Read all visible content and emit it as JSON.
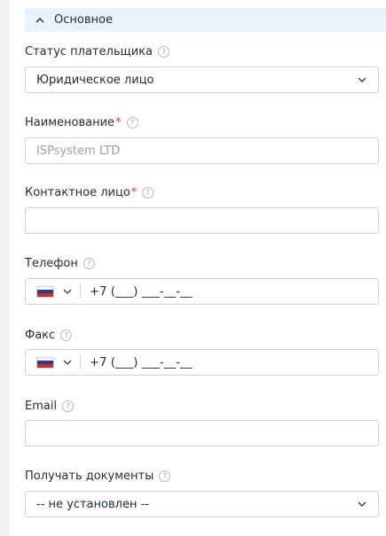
{
  "section": {
    "title": "Основное"
  },
  "fields": {
    "payer_status": {
      "label": "Статус плательщика",
      "help": "?",
      "value": "Юридическое лицо"
    },
    "name": {
      "label": "Наименование",
      "required": "*",
      "help": "?",
      "placeholder": "ISPsystem LTD"
    },
    "contact": {
      "label": "Контактное лицо",
      "required": "*",
      "help": "?",
      "value": ""
    },
    "phone": {
      "label": "Телефон",
      "help": "?",
      "country": "RU",
      "value": "+7 (___) ___-__-__"
    },
    "fax": {
      "label": "Факс",
      "help": "?",
      "country": "RU",
      "value": "+7 (___) ___-__-__"
    },
    "email": {
      "label": "Email",
      "help": "?",
      "value": ""
    },
    "documents": {
      "label": "Получать документы",
      "help": "?",
      "value": "-- не установлен --"
    }
  },
  "colors": {
    "header_bg": "#e9f3fd",
    "required": "#e0342c",
    "border": "#cfd3d8"
  },
  "icons": {
    "section_toggle": "chevron-up-icon",
    "dropdown": "chevron-down-icon",
    "help": "question-circle-icon",
    "flag": "russia-flag-icon"
  }
}
